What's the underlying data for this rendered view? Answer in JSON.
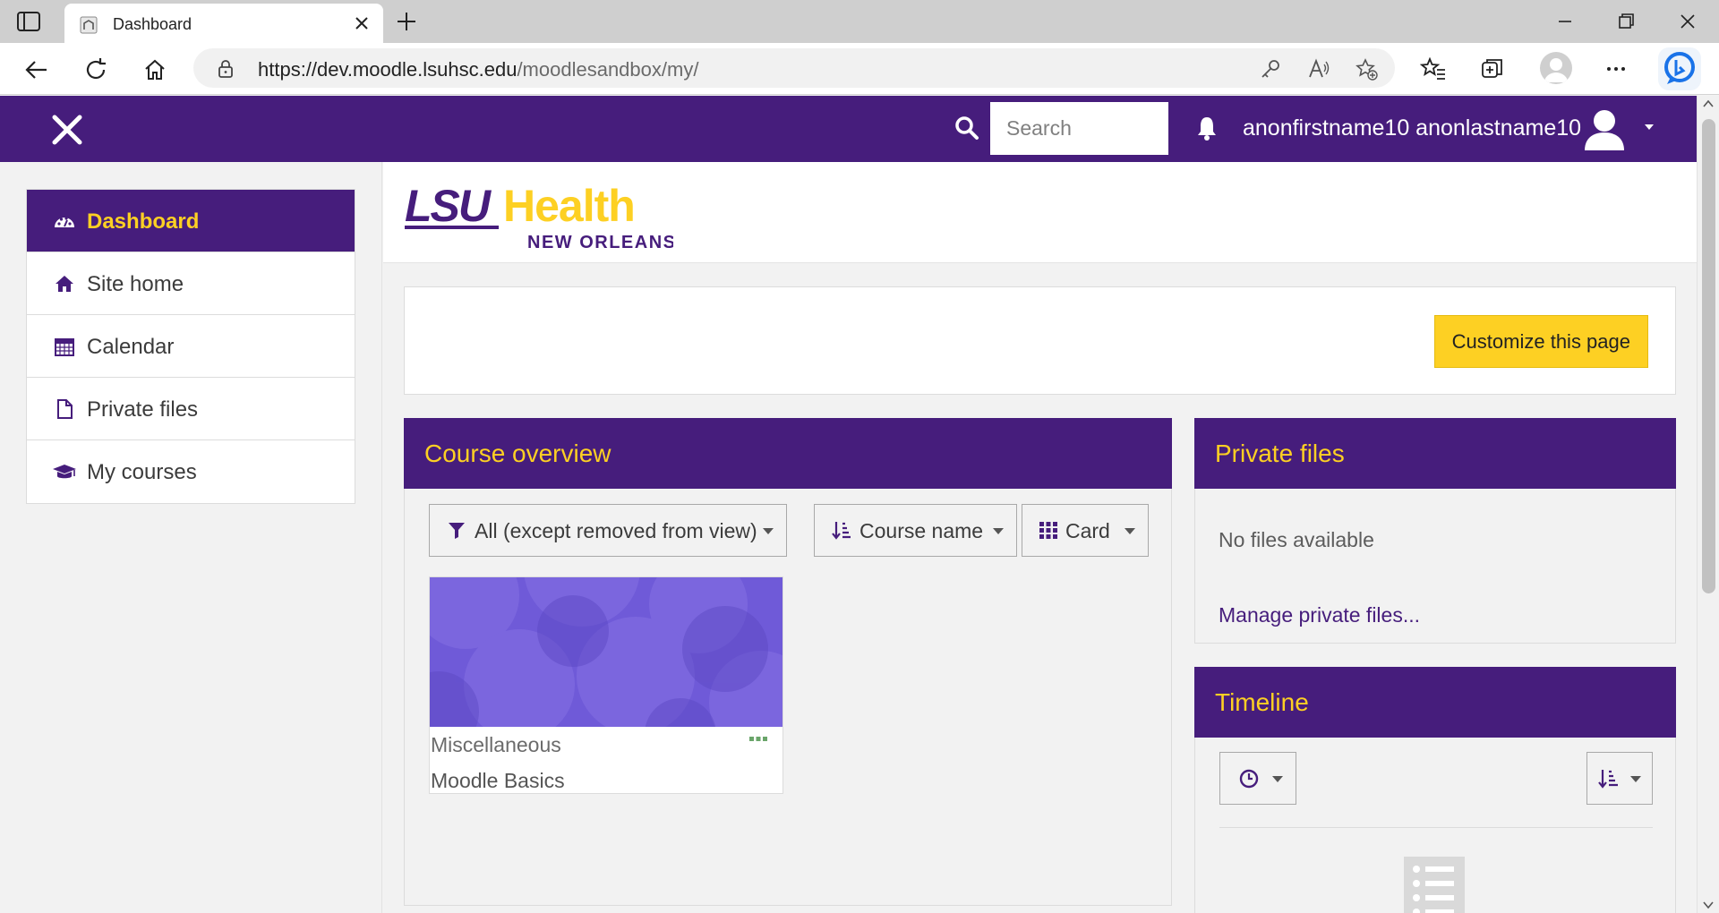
{
  "browser": {
    "tab_title": "Dashboard",
    "url_domain": "https://dev.moodle.lsuhsc.edu",
    "url_path": "/moodlesandbox/my/"
  },
  "navbar": {
    "search_placeholder": "Search",
    "username": "anonfirstname10 anonlastname10"
  },
  "nav": {
    "items": [
      {
        "label": "Dashboard",
        "icon": "dashboard-icon",
        "active": true
      },
      {
        "label": "Site home",
        "icon": "home-icon",
        "active": false
      },
      {
        "label": "Calendar",
        "icon": "calendar-icon",
        "active": false
      },
      {
        "label": "Private files",
        "icon": "file-icon",
        "active": false
      },
      {
        "label": "My courses",
        "icon": "graduation-cap-icon",
        "active": false
      }
    ]
  },
  "logo": {
    "line1a": "LSU",
    "line1b": "Health",
    "line2": "NEW ORLEANS"
  },
  "customize": {
    "button_label": "Customize this page"
  },
  "course_overview": {
    "title": "Course overview",
    "filter_label": "All (except removed from view)",
    "sort_label": "Course name",
    "view_label": "Card",
    "courses": [
      {
        "category": "Miscellaneous",
        "name": "Moodle Basics"
      }
    ]
  },
  "private_files": {
    "title": "Private files",
    "empty_text": "No files available",
    "manage_link": "Manage private files..."
  },
  "timeline": {
    "title": "Timeline"
  },
  "colors": {
    "brand_purple": "#461d7c",
    "brand_gold": "#fdd023",
    "course_image": "#6f5ad8"
  }
}
